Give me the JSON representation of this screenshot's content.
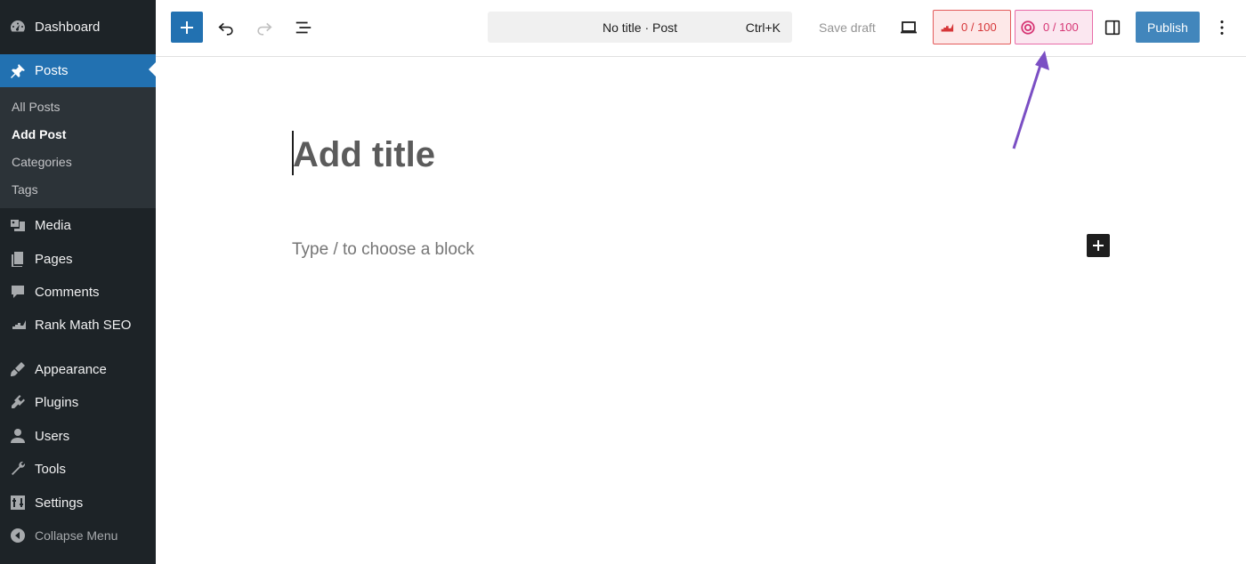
{
  "sidebar": {
    "items": [
      {
        "label": "Dashboard",
        "icon": "dashboard-icon"
      },
      {
        "label": "Posts",
        "icon": "pin-icon"
      },
      {
        "label": "Media",
        "icon": "media-icon"
      },
      {
        "label": "Pages",
        "icon": "pages-icon"
      },
      {
        "label": "Comments",
        "icon": "comments-icon"
      },
      {
        "label": "Rank Math SEO",
        "icon": "rank-math-icon"
      },
      {
        "label": "Appearance",
        "icon": "appearance-icon"
      },
      {
        "label": "Plugins",
        "icon": "plugins-icon"
      },
      {
        "label": "Users",
        "icon": "users-icon"
      },
      {
        "label": "Tools",
        "icon": "tools-icon"
      },
      {
        "label": "Settings",
        "icon": "settings-icon"
      }
    ],
    "posts_submenu": [
      "All Posts",
      "Add Post",
      "Categories",
      "Tags"
    ],
    "collapse_label": "Collapse Menu"
  },
  "toolbar": {
    "doc_title": "No title · Post",
    "shortcut": "Ctrl+K",
    "save_draft": "Save draft",
    "seo_score": "0 / 100",
    "content_ai_score": "0 / 100",
    "publish": "Publish"
  },
  "editor": {
    "title_placeholder": "Add title",
    "block_placeholder": "Type / to choose a block"
  },
  "colors": {
    "sidebar_bg": "#1d2327",
    "accent": "#2271b1",
    "seo_score": "#d63638",
    "content_ai_score": "#d63574",
    "annotation_arrow": "#7b4fc4"
  }
}
